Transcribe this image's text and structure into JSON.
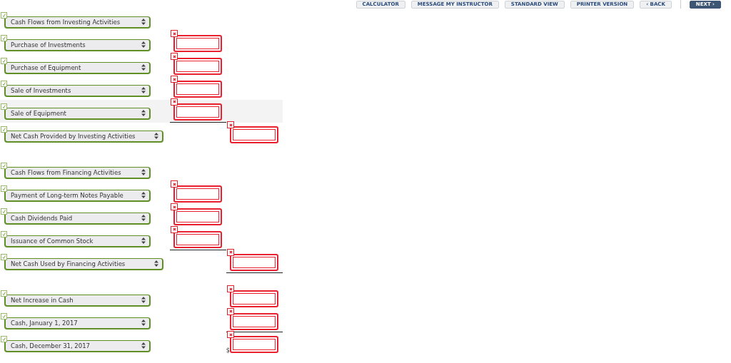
{
  "toolbar": {
    "buttons": [
      {
        "label": "CALCULATOR",
        "kind": "plain"
      },
      {
        "label": "MESSAGE MY INSTRUCTOR",
        "kind": "plain"
      },
      {
        "label": "STANDARD VIEW",
        "kind": "plain"
      },
      {
        "label": "PRINTER VERSION",
        "kind": "plain"
      },
      {
        "label": "‹ BACK",
        "kind": "plain"
      },
      {
        "label": "NEXT ›",
        "kind": "primary"
      }
    ]
  },
  "sections": [
    {
      "rows": [
        {
          "kind": "heading",
          "label": "Cash Flows from Investing Activities",
          "correct": true,
          "highlighted": false
        },
        {
          "kind": "item",
          "label": "Purchase of Investments",
          "correct": true,
          "amount": {
            "correct": false,
            "rule_below": false
          },
          "highlighted": false
        },
        {
          "kind": "item",
          "label": "Purchase of Equipment",
          "correct": true,
          "amount": {
            "correct": false,
            "rule_below": false
          },
          "highlighted": false
        },
        {
          "kind": "item",
          "label": "Sale of Investments",
          "correct": true,
          "amount": {
            "correct": false,
            "rule_below": false
          },
          "highlighted": false
        },
        {
          "kind": "item",
          "label": "Sale of Equipment",
          "correct": true,
          "amount": {
            "correct": false,
            "rule_below": true
          },
          "highlighted": true
        },
        {
          "kind": "total",
          "label": "Net Cash Provided by Investing Activities",
          "correct": true,
          "amount": {
            "correct": false,
            "rule_below": false
          },
          "highlighted": false
        }
      ]
    },
    {
      "rows": [
        {
          "kind": "heading",
          "label": "Cash Flows from Financing Activities",
          "correct": true,
          "highlighted": false
        },
        {
          "kind": "item",
          "label": "Payment of Long-term Notes Payable",
          "correct": true,
          "amount": {
            "correct": false,
            "rule_below": false
          },
          "highlighted": false
        },
        {
          "kind": "item",
          "label": "Cash Dividends Paid",
          "correct": true,
          "amount": {
            "correct": false,
            "rule_below": false
          },
          "highlighted": false
        },
        {
          "kind": "item",
          "label": "Issuance of Common Stock",
          "correct": true,
          "amount": {
            "correct": false,
            "rule_below": true
          },
          "highlighted": false
        },
        {
          "kind": "total",
          "label": "Net Cash Used by Financing Activities",
          "correct": true,
          "amount": {
            "correct": false,
            "rule_below": true
          },
          "highlighted": false
        }
      ]
    },
    {
      "rows": [
        {
          "kind": "summary",
          "label": "Net Increase in Cash",
          "correct": true,
          "amount": {
            "correct": false,
            "rule_below": false
          },
          "highlighted": false
        },
        {
          "kind": "summary",
          "label": "Cash, January 1, 2017",
          "correct": true,
          "amount": {
            "correct": false,
            "rule_below": true
          },
          "highlighted": false
        },
        {
          "kind": "summary",
          "label": "Cash, December 31, 2017",
          "correct": true,
          "amount": {
            "correct": false,
            "rule_below": false,
            "currency": "$"
          },
          "highlighted": false
        }
      ]
    }
  ]
}
